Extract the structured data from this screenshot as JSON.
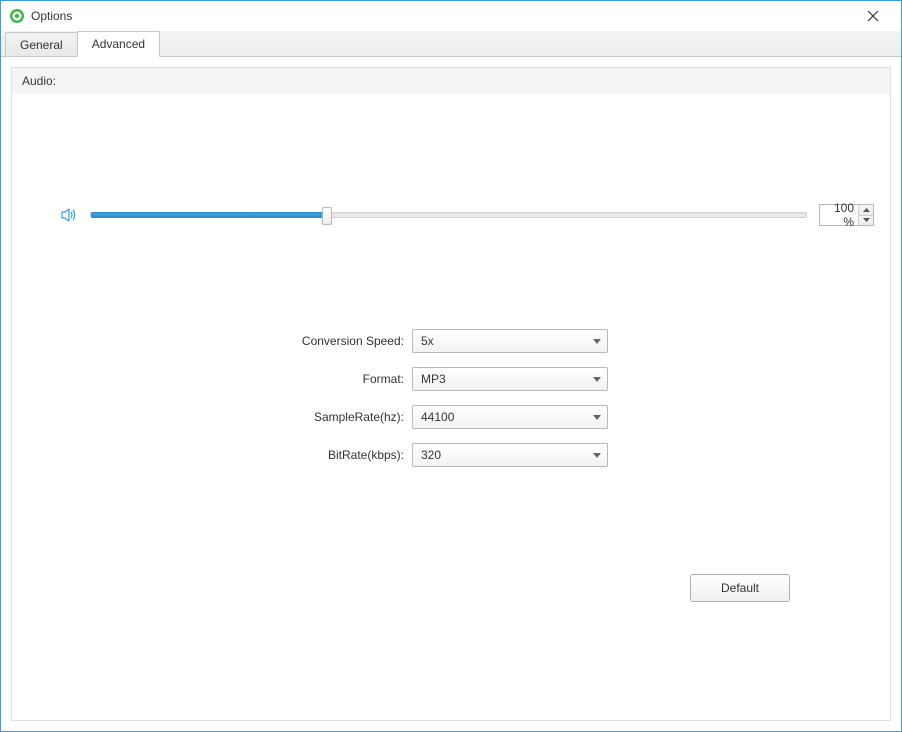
{
  "window": {
    "title": "Options"
  },
  "tabs": {
    "general": "General",
    "advanced": "Advanced"
  },
  "section": {
    "audio_label": "Audio:"
  },
  "volume": {
    "percent_display": "100 %",
    "fill_percent": 33
  },
  "fields": {
    "conversion_speed": {
      "label": "Conversion Speed:",
      "value": "5x"
    },
    "format": {
      "label": "Format:",
      "value": "MP3"
    },
    "sample_rate": {
      "label": "SampleRate(hz):",
      "value": "44100"
    },
    "bit_rate": {
      "label": "BitRate(kbps):",
      "value": "320"
    }
  },
  "buttons": {
    "default": "Default"
  }
}
